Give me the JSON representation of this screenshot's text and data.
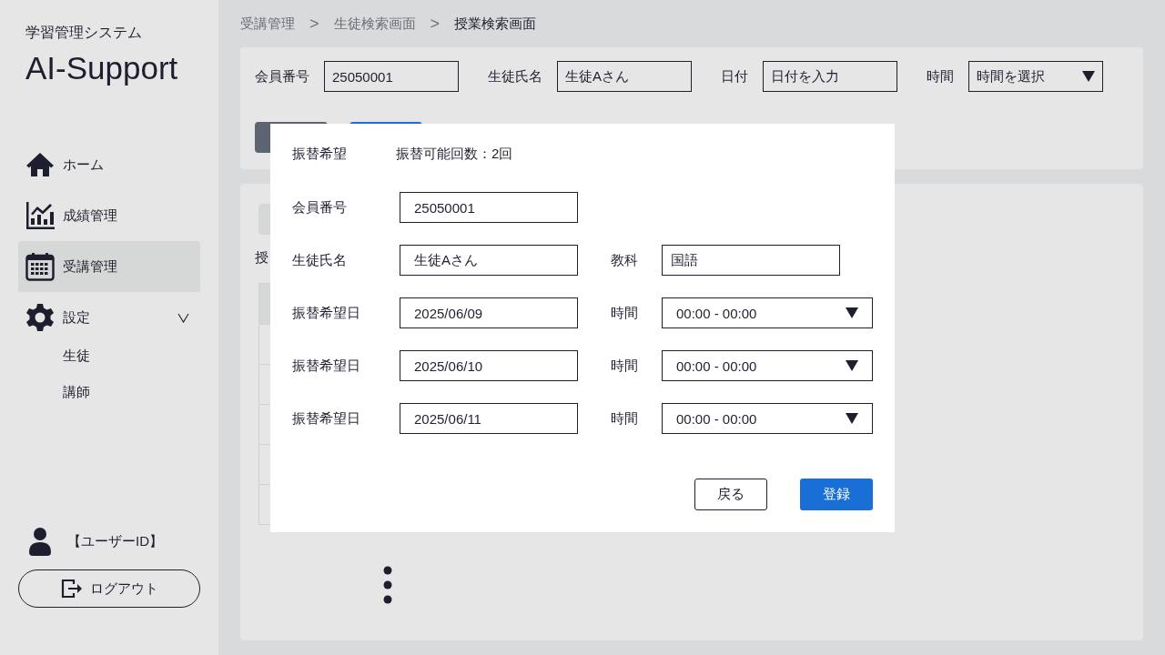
{
  "sidebar": {
    "subtitle": "学習管理システム",
    "title": "AI-Support",
    "nav": [
      {
        "kind": "home",
        "label": "ホーム",
        "selected": false
      },
      {
        "kind": "chart",
        "label": "成績管理",
        "selected": false
      },
      {
        "kind": "calendar",
        "label": "受講管理",
        "selected": true
      },
      {
        "kind": "settings",
        "label": "設定",
        "selected": false,
        "expanded": true,
        "children": [
          {
            "label": "生徒"
          },
          {
            "label": "講師"
          }
        ]
      }
    ],
    "user": "【ユーザーID】",
    "logout": "ログアウト"
  },
  "breadcrumb": [
    {
      "label": "受講管理",
      "current": false
    },
    {
      "label": "生徒検索画面",
      "current": false
    },
    {
      "label": "授業検索画面",
      "current": true
    }
  ],
  "breadcrumb_separator": ">",
  "filters": [
    {
      "label": "会員番号",
      "value": "25050001",
      "kind": "text"
    },
    {
      "label": "生徒氏名",
      "value": "生徒Aさん",
      "kind": "text"
    },
    {
      "label": "日付",
      "value": "日付を入力",
      "kind": "text"
    },
    {
      "label": "時間",
      "value": "時間を選択",
      "kind": "select"
    }
  ],
  "results": {
    "heading": "授"
  },
  "modal": {
    "title": "振替希望",
    "note": "振替可能回数：2回",
    "rows": [
      {
        "fields": [
          {
            "label": "会員番号",
            "value": "25050001",
            "kind": "text"
          }
        ]
      },
      {
        "fields": [
          {
            "label": "生徒氏名",
            "value": "生徒Aさん",
            "kind": "text"
          },
          {
            "label": "教科",
            "value": "国語",
            "kind": "text"
          }
        ]
      },
      {
        "fields": [
          {
            "label": "振替希望日",
            "value": "2025/06/09",
            "kind": "text"
          },
          {
            "label": "時間",
            "value": "00:00 - 00:00",
            "kind": "select"
          }
        ]
      },
      {
        "fields": [
          {
            "label": "振替希望日",
            "value": "2025/06/10",
            "kind": "text"
          },
          {
            "label": "時間",
            "value": "00:00 - 00:00",
            "kind": "select"
          }
        ]
      },
      {
        "fields": [
          {
            "label": "振替希望日",
            "value": "2025/06/11",
            "kind": "text"
          },
          {
            "label": "時間",
            "value": "00:00 - 00:00",
            "kind": "select"
          }
        ]
      }
    ],
    "back": "戻る",
    "submit": "登録"
  }
}
